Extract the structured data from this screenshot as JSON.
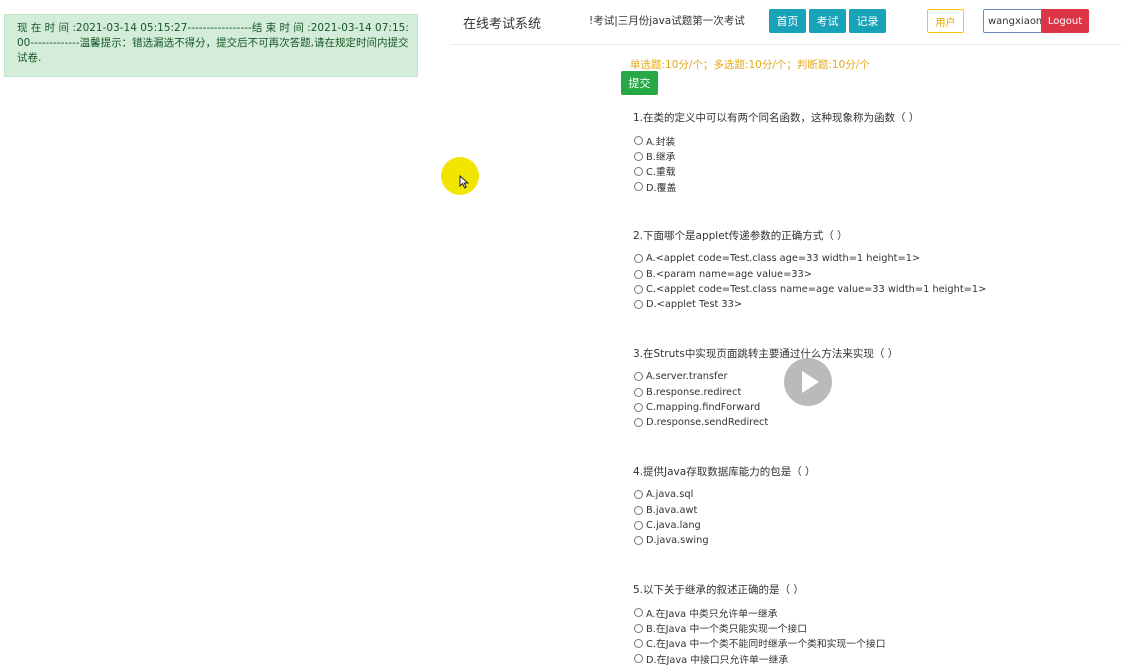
{
  "notice": {
    "text": "现 在 时 间 :2021-03-14 05:15:27-----------------结 束 时 间 :2021-03-14 07:15:00-------------温馨提示：错选漏选不得分，提交后不可再次答题,请在规定时间内提交试卷."
  },
  "navbar": {
    "brand": "在线考试系统",
    "exam_title": "!考试|三月份java试题第一次考试",
    "home_label": "首页",
    "exam_label": "考试",
    "record_label": "记录",
    "user_label": "用户",
    "username_value": "wangxiaom",
    "logout_label": "Logout"
  },
  "exam": {
    "score_info": "单选题:10分/个；多选题:10分/个；判断题:10分/个",
    "submit_label": "提交",
    "questions": [
      {
        "text": "1.在类的定义中可以有两个同名函数，这种现象称为函数（ ）",
        "options": [
          "A.封装",
          "B.继承",
          "C.重载",
          "D.覆盖"
        ]
      },
      {
        "text": "2.下面哪个是applet传递参数的正确方式（ ）",
        "options": [
          "A.<applet code=Test.class age=33 width=1 height=1>",
          "B.<param name=age value=33>",
          "C.<applet code=Test.class name=age value=33 width=1 height=1>",
          "D.<applet Test 33>"
        ]
      },
      {
        "text": "3.在Struts中实现页面跳转主要通过什么方法来实现（ ）",
        "options": [
          "A.server.transfer",
          "B.response.redirect",
          "C.mapping.findForward",
          "D.response.sendRedirect"
        ]
      },
      {
        "text": "4.提供Java存取数据库能力的包是（ ）",
        "options": [
          "A.java.sql",
          "B.java.awt",
          "C.java.lang",
          "D.java.swing"
        ]
      },
      {
        "text": "5.以下关于继承的叙述正确的是（ ）",
        "options": [
          "A.在Java 中类只允许单一继承",
          "B.在Java 中一个类只能实现一个接口",
          "C.在Java 中一个类不能同时继承一个类和实现一个接口",
          "D.在Java 中接口只允许单一继承"
        ]
      }
    ]
  },
  "icons": {
    "cursor": "mouse-cursor-icon",
    "play": "play-icon"
  },
  "colors": {
    "nav_button": "#17a2b8",
    "submit_button": "#28a745",
    "logout_button": "#dc3545",
    "user_button": "#ffc107",
    "score_text": "#e6a817",
    "notice_bg": "#d4edda",
    "cursor_highlight": "#f2e500"
  }
}
